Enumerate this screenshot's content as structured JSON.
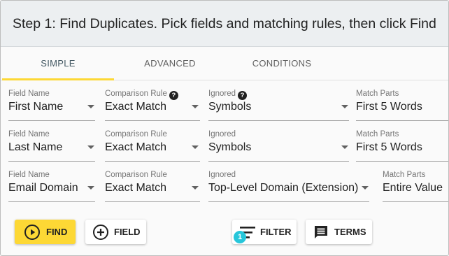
{
  "header": {
    "title": "Step 1: Find Duplicates. Pick fields and matching rules, then click Find"
  },
  "tabs": [
    {
      "label": "SIMPLE",
      "active": true
    },
    {
      "label": "ADVANCED",
      "active": false
    },
    {
      "label": "CONDITIONS",
      "active": false
    }
  ],
  "rows": [
    {
      "field_name": {
        "label": "Field Name",
        "value": "First Name"
      },
      "comparison_rule": {
        "label": "Comparison Rule",
        "value": "Exact Match",
        "help": "?"
      },
      "ignored": {
        "label": "Ignored",
        "value": "Symbols",
        "help": "?"
      },
      "match_parts": {
        "label": "Match Parts",
        "value": "First 5 Words"
      }
    },
    {
      "field_name": {
        "label": "Field Name",
        "value": "Last Name"
      },
      "comparison_rule": {
        "label": "Comparison Rule",
        "value": "Exact Match"
      },
      "ignored": {
        "label": "Ignored",
        "value": "Symbols"
      },
      "match_parts": {
        "label": "Match Parts",
        "value": "First 5 Words"
      }
    },
    {
      "field_name": {
        "label": "Field Name",
        "value": "Email Domain"
      },
      "comparison_rule": {
        "label": "Comparison Rule",
        "value": "Exact Match"
      },
      "ignored": {
        "label": "Ignored",
        "value": "Top-Level Domain (Extension)"
      },
      "match_parts": {
        "label": "Match Parts",
        "value": "Entire Value"
      }
    }
  ],
  "actions": {
    "find": "FIND",
    "field": "FIELD",
    "filter": "FILTER",
    "filter_count": "1",
    "terms": "TERMS"
  },
  "colors": {
    "accent": "#fdd835",
    "badge": "#26c6da",
    "header_bg": "#eceff1"
  },
  "icons": [
    "help-icon",
    "chevron-down-icon",
    "play-circle-icon",
    "add-circle-icon",
    "filter-icon",
    "message-icon"
  ]
}
